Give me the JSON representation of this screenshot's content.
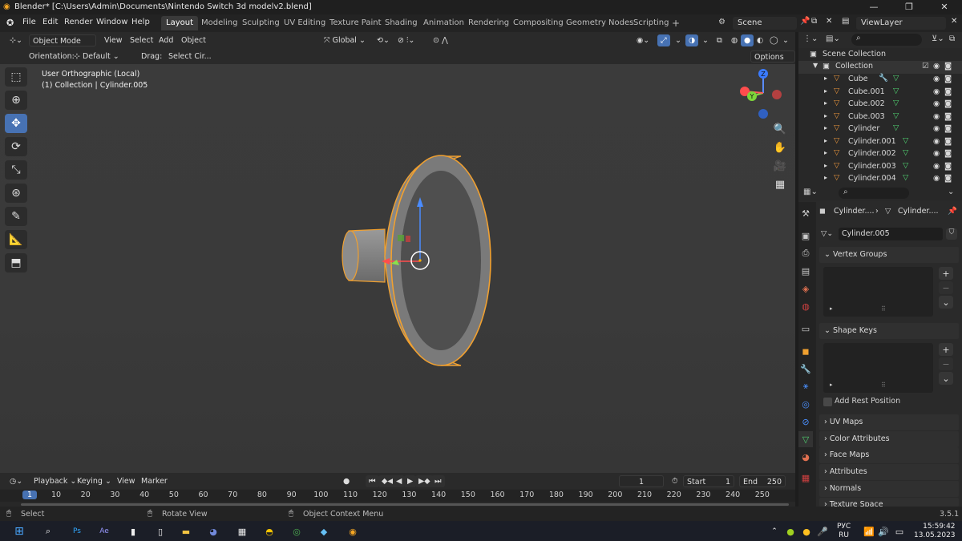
{
  "window": {
    "title": "Blender* [C:\\Users\\Admin\\Documents\\Nintendo Switch 3d modelv2.blend]",
    "min": "—",
    "max": "❐",
    "close": "✕"
  },
  "menu": [
    "File",
    "Edit",
    "Render",
    "Window",
    "Help"
  ],
  "workspaces": [
    "Layout",
    "Modeling",
    "Sculpting",
    "UV Editing",
    "Texture Paint",
    "Shading",
    "Animation",
    "Rendering",
    "Compositing",
    "Geometry Nodes",
    "Scripting"
  ],
  "workspace_add": "+",
  "scene": {
    "name": "Scene",
    "view_layer": "ViewLayer"
  },
  "viewport_header": {
    "mode": "Object Mode",
    "view": "View",
    "select": "Select",
    "add": "Add",
    "object": "Object",
    "transform": "Global",
    "options": "Options"
  },
  "tool_settings": {
    "orientation_label": "Orientation:",
    "orientation": "Default",
    "drag_label": "Drag:",
    "drag": "Select Cir..."
  },
  "viewport_info": {
    "view": "User Orthographic (Local)",
    "collection": "(1) Collection | Cylinder.005"
  },
  "gizmo": {
    "z": "Z",
    "y": "Y",
    "x": "X"
  },
  "timeline": {
    "playback": "Playback",
    "keying": "Keying",
    "view": "View",
    "marker": "Marker",
    "current_frame": "1",
    "start_label": "Start",
    "start": "1",
    "end_label": "End",
    "end": "250"
  },
  "ruler_ticks": [
    "1",
    "10",
    "20",
    "30",
    "40",
    "50",
    "60",
    "70",
    "80",
    "90",
    "100",
    "110",
    "120",
    "130",
    "140",
    "150",
    "160",
    "170",
    "180",
    "190",
    "200",
    "210",
    "220",
    "230",
    "240",
    "250"
  ],
  "status": {
    "select": "Select",
    "rotate": "Rotate View",
    "context": "Object Context Menu",
    "version": "3.5.1"
  },
  "outliner": {
    "scene_collection": "Scene Collection",
    "collection": "Collection",
    "items": [
      "Cube",
      "Cube.001",
      "Cube.002",
      "Cube.003",
      "Cylinder",
      "Cylinder.001",
      "Cylinder.002",
      "Cylinder.003",
      "Cylinder.004"
    ]
  },
  "properties": {
    "breadcrumb_object": "Cylinder....",
    "breadcrumb_mesh": "Cylinder....",
    "mesh_name": "Cylinder.005",
    "vertex_groups": "Vertex Groups",
    "shape_keys": "Shape Keys",
    "add_rest_position": "Add Rest Position",
    "panels": [
      "UV Maps",
      "Color Attributes",
      "Face Maps",
      "Attributes",
      "Normals",
      "Texture Space"
    ]
  },
  "taskbar": {
    "lang1": "РУС",
    "lang2": "RU",
    "time": "15:59:42",
    "date": "13.05.2023"
  },
  "colors": {
    "accent": "#4772b3",
    "selection_outline": "#f5a623",
    "mesh_icon": "#e4923b"
  }
}
